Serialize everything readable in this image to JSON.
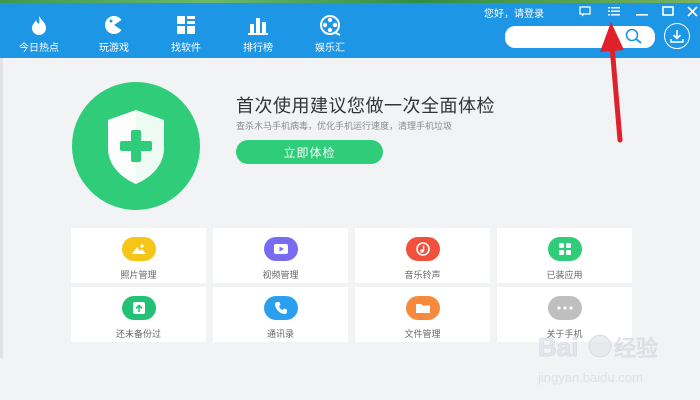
{
  "nav": {
    "items": [
      {
        "label": "今日热点",
        "icon": "flame-icon"
      },
      {
        "label": "玩游戏",
        "icon": "gamepad-icon"
      },
      {
        "label": "找软件",
        "icon": "apps-grid-icon"
      },
      {
        "label": "排行榜",
        "icon": "bar-chart-icon"
      },
      {
        "label": "娱乐汇",
        "icon": "film-reel-icon"
      }
    ]
  },
  "header": {
    "login_text": "您好，请登录",
    "search_placeholder": ""
  },
  "hero": {
    "title": "首次使用建议您做一次全面体检",
    "subtitle": "查杀木马手机病毒，优化手机运行速度，清理手机垃圾",
    "button_label": "立即体检"
  },
  "tiles": [
    {
      "label": "照片管理",
      "icon": "photo-icon",
      "color": "#f5c518"
    },
    {
      "label": "视频管理",
      "icon": "video-play-icon",
      "color": "#7a6cf0"
    },
    {
      "label": "音乐铃声",
      "icon": "music-icon",
      "color": "#f0503c"
    },
    {
      "label": "已装应用",
      "icon": "installed-apps-icon",
      "color": "#2fcc7a"
    },
    {
      "label": "还未备份过",
      "icon": "backup-icon",
      "color": "#22c173"
    },
    {
      "label": "通讯录",
      "icon": "phone-icon",
      "color": "#2a9ff0"
    },
    {
      "label": "文件管理",
      "icon": "folder-icon",
      "color": "#f58a3c"
    },
    {
      "label": "关于手机",
      "icon": "more-dots-icon",
      "color": "#bfbfbf"
    }
  ],
  "colors": {
    "topbar": "#1e96e6",
    "accent_green": "#2fcc7a",
    "annotation_arrow": "#e0202a"
  },
  "watermark": {
    "brand": "Baidu经验",
    "url": "jingyan.baidu.com"
  }
}
